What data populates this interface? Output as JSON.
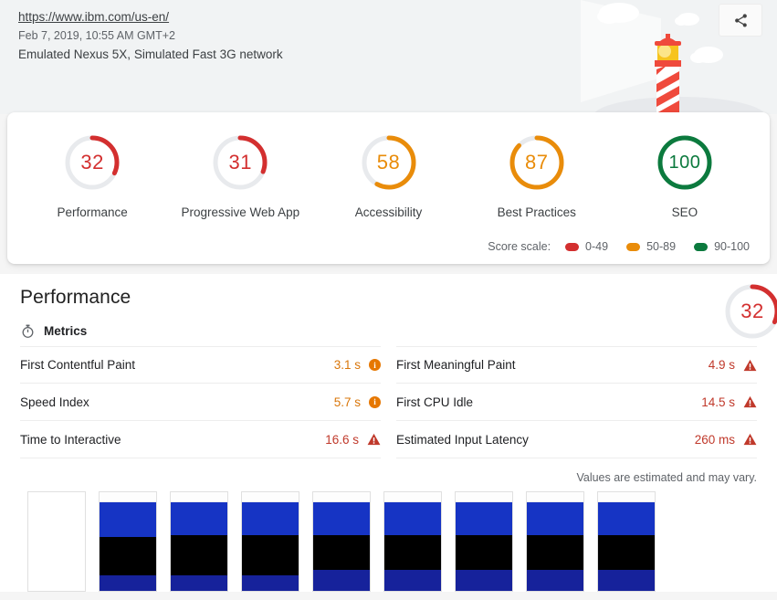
{
  "header": {
    "url": "https://www.ibm.com/us-en/",
    "timestamp": "Feb 7, 2019, 10:55 AM GMT+2",
    "environment": "Emulated Nexus 5X, Simulated Fast 3G network",
    "share_icon": "share-icon"
  },
  "scores": {
    "categories": [
      {
        "label": "Performance",
        "value": 32,
        "color": "#d32f2f"
      },
      {
        "label": "Progressive Web App",
        "value": 31,
        "color": "#d32f2f"
      },
      {
        "label": "Accessibility",
        "value": 58,
        "color": "#e98c0a"
      },
      {
        "label": "Best Practices",
        "value": 87,
        "color": "#e98c0a"
      },
      {
        "label": "SEO",
        "value": 100,
        "color": "#0c7a3e"
      }
    ],
    "scale_label": "Score scale:",
    "scale_items": [
      {
        "range": "0-49",
        "color": "#d32f2f"
      },
      {
        "range": "50-89",
        "color": "#e98c0a"
      },
      {
        "range": "90-100",
        "color": "#0c7a3e"
      }
    ]
  },
  "performance": {
    "title": "Performance",
    "score": 32,
    "score_color": "#d32f2f",
    "metrics_label": "Metrics",
    "metrics_icon": "stopwatch-icon",
    "estimated_note": "Values are estimated and may vary.",
    "left_metrics": [
      {
        "name": "First Contentful Paint",
        "value": "3.1 s",
        "status": "avg",
        "icon": "info-icon"
      },
      {
        "name": "Speed Index",
        "value": "5.7 s",
        "status": "avg",
        "icon": "info-icon"
      },
      {
        "name": "Time to Interactive",
        "value": "16.6 s",
        "status": "fail",
        "icon": "warning-icon"
      }
    ],
    "right_metrics": [
      {
        "name": "First Meaningful Paint",
        "value": "4.9 s",
        "status": "fail",
        "icon": "warning-icon"
      },
      {
        "name": "First CPU Idle",
        "value": "14.5 s",
        "status": "fail",
        "icon": "warning-icon"
      },
      {
        "name": "Estimated Input Latency",
        "value": "260 ms",
        "status": "fail",
        "icon": "warning-icon"
      }
    ],
    "filmstrip": [
      {
        "state": "blank"
      },
      {
        "state": "hero"
      },
      {
        "state": "heading"
      },
      {
        "state": "heading"
      },
      {
        "state": "full"
      },
      {
        "state": "full"
      },
      {
        "state": "full"
      },
      {
        "state": "full"
      },
      {
        "state": "full"
      }
    ]
  }
}
